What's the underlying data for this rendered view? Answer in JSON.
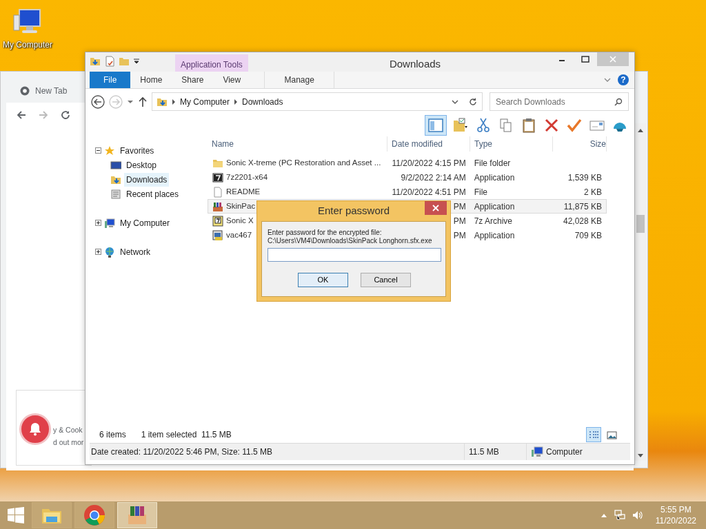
{
  "desktop_icons": [
    {
      "label": "My Computer"
    }
  ],
  "browser_window": {
    "tab": "New Tab",
    "card_lines": [
      "y & Cook",
      "d out mor"
    ]
  },
  "explorer": {
    "title": "Downloads",
    "contextual_tab": "Application Tools",
    "ribbon_tabs": [
      {
        "label": "File",
        "kind": "file",
        "selected": false
      },
      {
        "label": "Home",
        "kind": "tab",
        "selected": false
      },
      {
        "label": "Share",
        "kind": "tab",
        "selected": false
      },
      {
        "label": "View",
        "kind": "tab",
        "selected": false
      },
      {
        "label": "Manage",
        "kind": "contextual",
        "selected": false
      }
    ],
    "breadcrumb": [
      "My Computer",
      "Downloads"
    ],
    "help_label": "?",
    "search": {
      "placeholder": "Search Downloads"
    },
    "nav_tree": [
      {
        "label": "Favorites",
        "kind": "favorites",
        "expanded": true,
        "selected": false,
        "children": [
          {
            "label": "Desktop",
            "kind": "desktop",
            "selected": false
          },
          {
            "label": "Downloads",
            "kind": "downloads",
            "selected": true
          },
          {
            "label": "Recent places",
            "kind": "recent",
            "selected": false
          }
        ]
      },
      {
        "label": "My Computer",
        "kind": "computer",
        "expanded": false,
        "selected": false
      },
      {
        "label": "Network",
        "kind": "network",
        "expanded": false,
        "selected": false
      }
    ],
    "columns": [
      "Name",
      "Date modified",
      "Type",
      "Size"
    ],
    "files": [
      {
        "name": "Sonic X-treme (PC Restoration and Asset ...",
        "date": "11/20/2022 4:15 PM",
        "type": "File folder",
        "kind": "folder",
        "selected": false
      },
      {
        "name": "7z2201-x64",
        "date": "9/2/2022 2:14 AM",
        "type": "Application",
        "size": "1,539 KB",
        "kind": "sevenzip-app",
        "selected": false
      },
      {
        "name": "README",
        "date": "11/20/2022 4:51 PM",
        "type": "File",
        "size": "2 KB",
        "kind": "document",
        "selected": false
      },
      {
        "name": "SkinPac",
        "date": "PM",
        "type": "Application",
        "size": "11,875 KB",
        "kind": "archive-app",
        "selected": true
      },
      {
        "name": "Sonic X",
        "date": "PM",
        "type": "7z Archive",
        "size": "42,028 KB",
        "kind": "sevenzip-archive",
        "selected": false
      },
      {
        "name": "vac467",
        "date": "PM",
        "type": "Application",
        "size": "709 KB",
        "kind": "setup-app",
        "selected": false
      }
    ],
    "status": {
      "count": "6 items",
      "selection": "1 item selected  11.5 MB"
    },
    "view_buttons": [
      {
        "kind": "details",
        "selected": true
      },
      {
        "kind": "large-icons",
        "selected": false
      }
    ],
    "details_bar": {
      "info": "Date created: 11/20/2022 5:46 PM, Size: 11.5 MB",
      "size": "11.5 MB",
      "location": "Computer"
    }
  },
  "dialog": {
    "title": "Enter password",
    "message": [
      "Enter password for the encrypted file:",
      "C:\\Users\\VM4\\Downloads\\SkinPack Longhorn.sfx.exe"
    ],
    "buttons": [
      {
        "label": "OK",
        "default": true
      },
      {
        "label": "Cancel",
        "default": false
      }
    ]
  },
  "taskbar": {
    "apps": [
      {
        "kind": "explorer",
        "selected": false
      },
      {
        "kind": "chrome",
        "selected": false
      },
      {
        "kind": "winrar",
        "selected": true
      }
    ],
    "time": "5:55 PM",
    "date": "11/20/2022"
  }
}
